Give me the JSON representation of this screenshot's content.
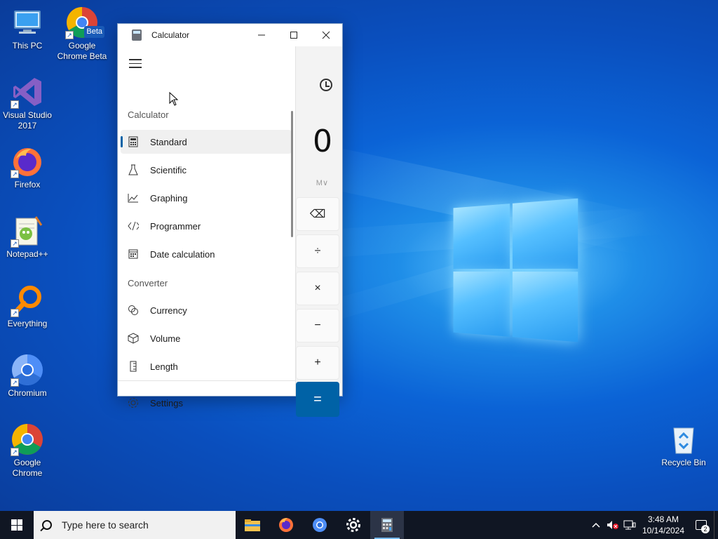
{
  "desktop": {
    "icons": [
      {
        "label": "This PC",
        "icon": "computer-icon"
      },
      {
        "label": "Google Chrome Beta",
        "icon": "chrome-beta-icon",
        "badge": "Beta"
      },
      {
        "label": "Visual Studio 2017",
        "icon": "visual-studio-icon"
      },
      {
        "label": "Firefox",
        "icon": "firefox-icon"
      },
      {
        "label": "Notepad++",
        "icon": "notepad-plus-plus-icon"
      },
      {
        "label": "Everything",
        "icon": "everything-search-icon"
      },
      {
        "label": "Chromium",
        "icon": "chromium-icon"
      },
      {
        "label": "Google Chrome",
        "icon": "chrome-icon"
      },
      {
        "label": "Recycle Bin",
        "icon": "recycle-bin-icon"
      }
    ]
  },
  "calculator": {
    "title": "Calculator",
    "display": "0",
    "memory_label": "M∨",
    "keys": {
      "backspace": "⌫",
      "divide": "÷",
      "multiply": "×",
      "minus": "−",
      "plus": "+",
      "equals": "="
    },
    "nav": {
      "section_calculator": "Calculator",
      "section_converter": "Converter",
      "items": [
        {
          "label": "Standard",
          "icon": "calculator-icon"
        },
        {
          "label": "Scientific",
          "icon": "flask-icon"
        },
        {
          "label": "Graphing",
          "icon": "graph-icon"
        },
        {
          "label": "Programmer",
          "icon": "code-icon"
        },
        {
          "label": "Date calculation",
          "icon": "calendar-icon"
        },
        {
          "label": "Currency",
          "icon": "currency-icon"
        },
        {
          "label": "Volume",
          "icon": "cube-icon"
        },
        {
          "label": "Length",
          "icon": "ruler-icon"
        }
      ],
      "settings": "Settings"
    }
  },
  "taskbar": {
    "search_placeholder": "Type here to search",
    "apps": [
      "file-explorer-icon",
      "firefox-icon",
      "chromium-icon",
      "settings-gear-icon",
      "calculator-icon"
    ],
    "time": "3:48 AM",
    "date": "10/14/2024",
    "notification_count": "2"
  }
}
